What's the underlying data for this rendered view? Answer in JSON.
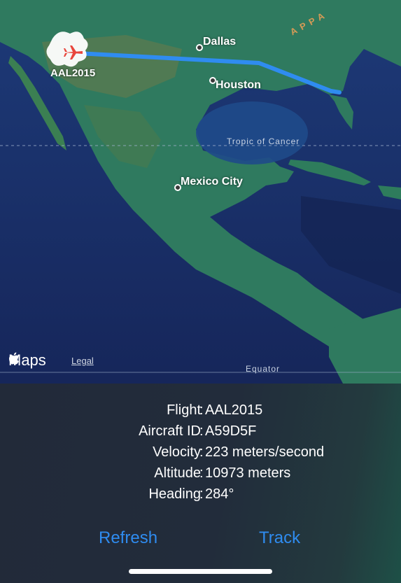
{
  "map": {
    "cities": [
      {
        "name": "Dallas"
      },
      {
        "name": "Houston"
      },
      {
        "name": "Mexico City"
      }
    ],
    "lines": {
      "tropic": "Tropic of Cancer",
      "equator": "Equator"
    },
    "mountain_label": "APPA",
    "flight_marker_label": "AAL2015",
    "attribution": {
      "brand": "Maps",
      "legal": "Legal"
    },
    "colors": {
      "route": "#2f8cf0",
      "plane": "#e8453c"
    }
  },
  "info": {
    "rows": [
      {
        "key": "Flight",
        "value": "AAL2015"
      },
      {
        "key": "Aircraft ID",
        "value": "A59D5F"
      },
      {
        "key": "Velocity",
        "value": "223 meters/second"
      },
      {
        "key": "Altitude",
        "value": "10973 meters"
      },
      {
        "key": "Heading",
        "value": "284°"
      }
    ],
    "separator": ":"
  },
  "actions": {
    "refresh": "Refresh",
    "track": "Track"
  }
}
